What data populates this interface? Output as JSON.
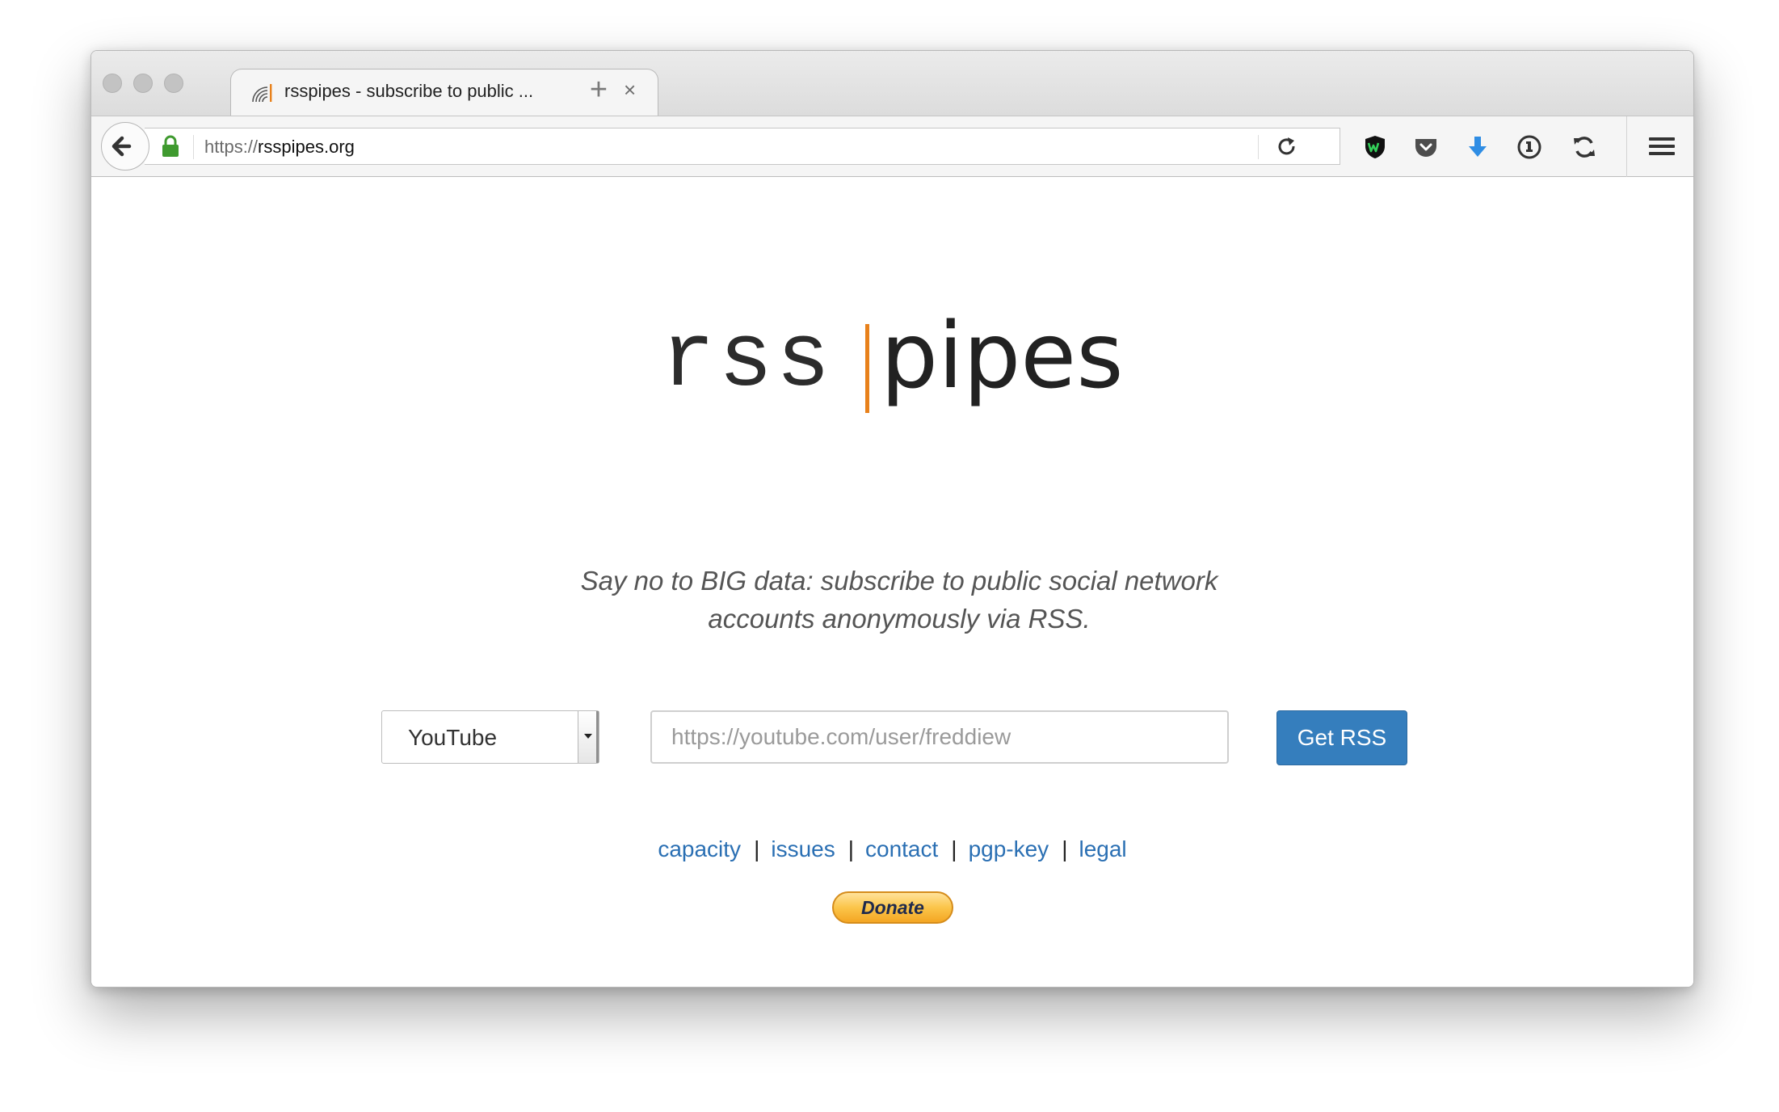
{
  "browser": {
    "tab": {
      "title": "rsspipes - subscribe to public ...",
      "close_glyph": "×",
      "favicon": "rss-feed-icon"
    },
    "new_tab_glyph": "+",
    "address": {
      "scheme": "https://",
      "host": "rsspipes.org"
    },
    "toolbar_icons": [
      "reload-icon",
      "shield-extension-icon",
      "pocket-icon",
      "download-icon",
      "password-manager-icon",
      "sync-icon",
      "hamburger-menu-icon"
    ],
    "colors": {
      "secure_lock": "#3f9a2f",
      "download_arrow": "#2f8de4"
    }
  },
  "page": {
    "logo": {
      "left": "rss",
      "right": "pipes",
      "accent_color": "#e8811b"
    },
    "tagline": {
      "line1": "Say no to BIG data: subscribe to public social network",
      "line2": "accounts anonymously via RSS."
    },
    "form": {
      "service_selected": "YouTube",
      "url_placeholder": "https://youtube.com/user/freddiew",
      "url_value": "",
      "submit_label": "Get RSS",
      "submit_color": "#357ebd"
    },
    "footer": {
      "links": [
        "capacity",
        "issues",
        "contact",
        "pgp-key",
        "legal"
      ],
      "separator": "|",
      "link_color": "#2a6fb3"
    },
    "donate_label": "Donate"
  }
}
